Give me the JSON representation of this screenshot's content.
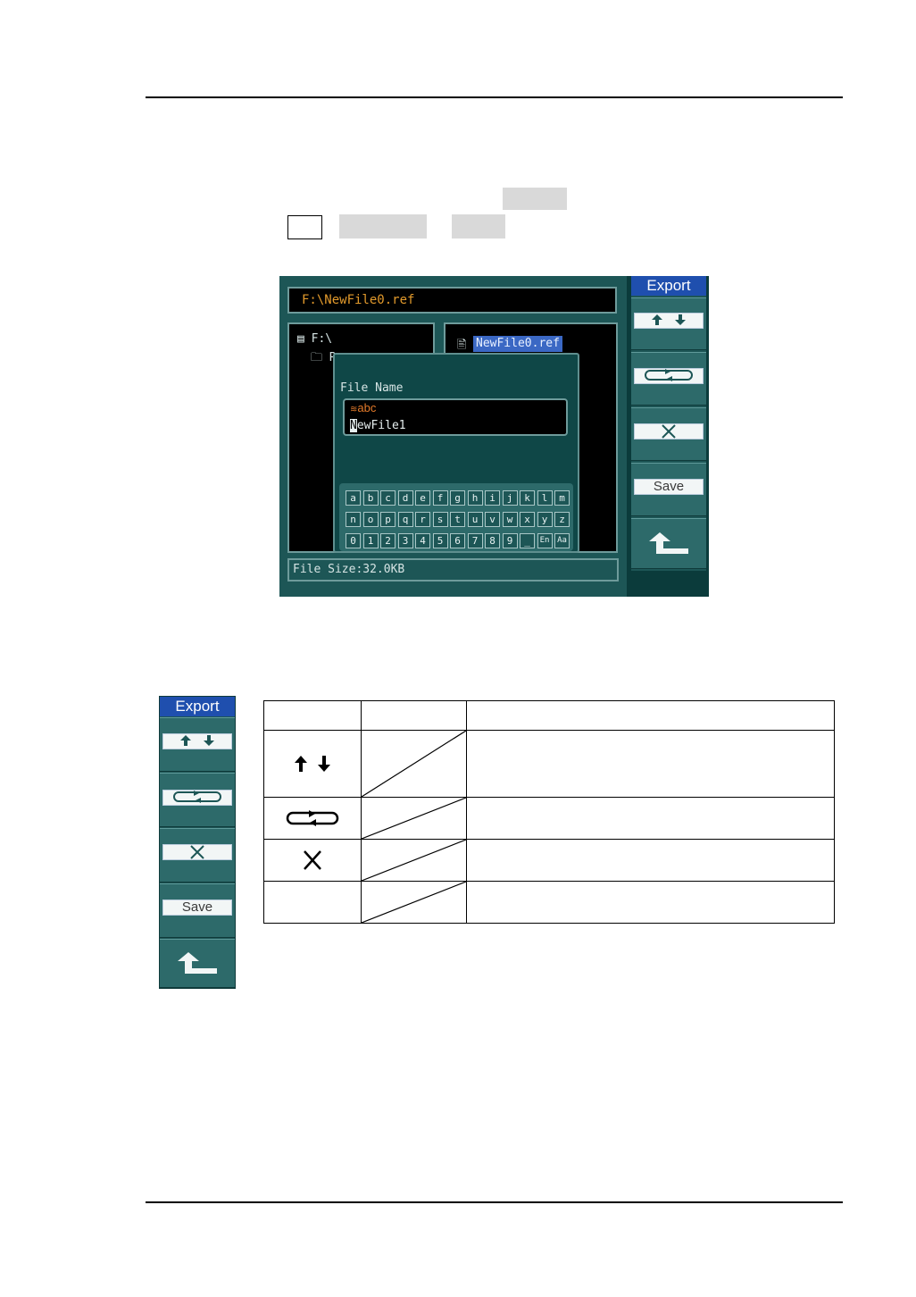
{
  "scope": {
    "path": "F:\\NewFile0.ref",
    "tree_root": "F:\\",
    "tree_child": "R",
    "selected_file": "NewFile0.ref",
    "file_size": "File Size:32.0KB",
    "dialog": {
      "title": "File Name",
      "input_mode": "abc",
      "filename_first": "N",
      "filename_rest": "ewFile1"
    },
    "keyboard": {
      "row1": [
        "a",
        "b",
        "c",
        "d",
        "e",
        "f",
        "g",
        "h",
        "i",
        "j",
        "k",
        "l",
        "m"
      ],
      "row2": [
        "n",
        "o",
        "p",
        "q",
        "r",
        "s",
        "t",
        "u",
        "v",
        "w",
        "x",
        "y",
        "z"
      ],
      "row3": [
        "0",
        "1",
        "2",
        "3",
        "4",
        "5",
        "6",
        "7",
        "8",
        "9",
        "_",
        "En",
        "Aa"
      ]
    },
    "menu": {
      "title": "Export",
      "save_label": "Save"
    }
  },
  "side_menu": {
    "title": "Export",
    "save_label": "Save"
  },
  "table": {
    "headers": [
      "",
      "",
      ""
    ],
    "rows": [
      {
        "option": "up-down-arrows-icon",
        "setting": "",
        "comment": ""
      },
      {
        "option": "switch-icon",
        "setting": "",
        "comment": ""
      },
      {
        "option": "delete-x-icon",
        "setting": "",
        "comment": ""
      },
      {
        "option": "",
        "setting": "",
        "comment": ""
      }
    ]
  },
  "colors": {
    "screen_bg": "#1d5656",
    "menu_title": "#1f4fae",
    "path_text": "#e29a2c",
    "selected_file_bg": "#3b68c4"
  }
}
